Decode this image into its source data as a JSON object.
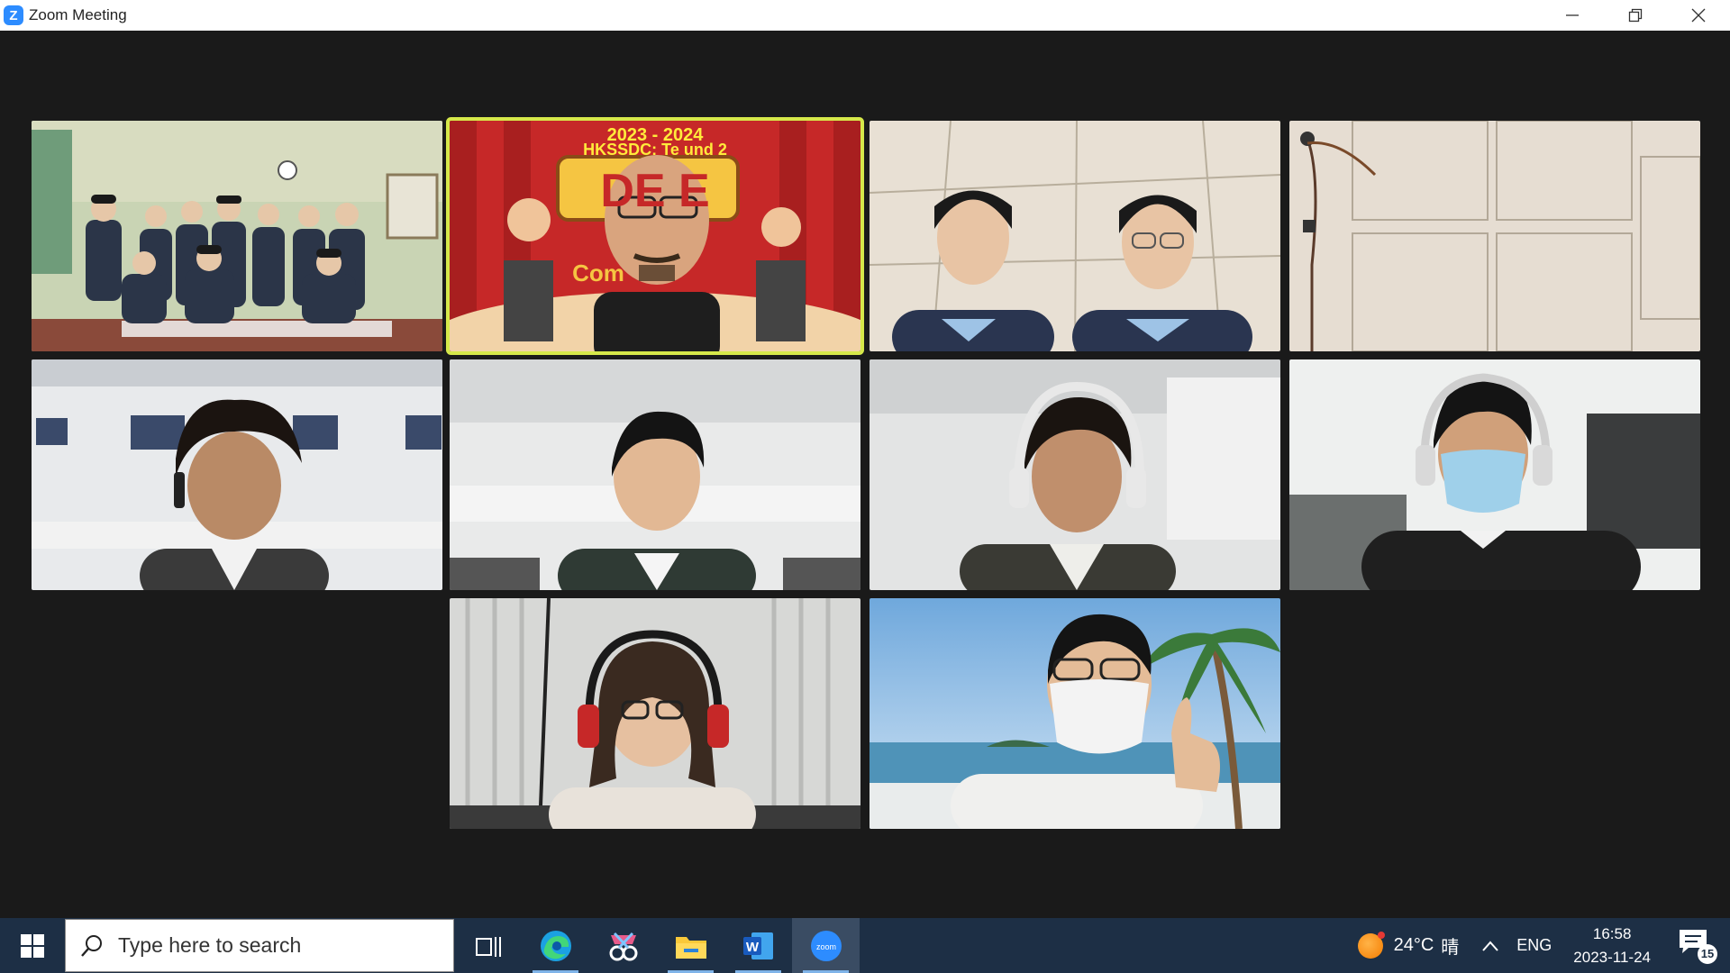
{
  "window": {
    "title": "Zoom Meeting",
    "logo_glyph": "Z",
    "controls": [
      "minimize-icon",
      "restore-icon",
      "close-icon"
    ]
  },
  "meeting": {
    "tiles": [
      {
        "id": "group-students",
        "active": false
      },
      {
        "id": "presenter",
        "active": true,
        "banner_year": "2023 - 2024",
        "banner_title": "HKSSDC: Te          und 2",
        "banner_big": "DE      E",
        "banner_sub": "Com"
      },
      {
        "id": "two-students",
        "active": false
      },
      {
        "id": "empty-room",
        "active": false
      },
      {
        "id": "student-curly",
        "active": false
      },
      {
        "id": "student-plain",
        "active": false
      },
      {
        "id": "student-headset",
        "active": false
      },
      {
        "id": "student-mask",
        "active": false
      },
      {
        "id": "student-glasses-headphones",
        "active": false
      },
      {
        "id": "student-beach",
        "active": false
      }
    ]
  },
  "taskbar": {
    "search_placeholder": "Type here to search",
    "apps": [
      "task-view-icon",
      "edge-icon",
      "snip-icon",
      "file-explorer-icon",
      "word-icon",
      "zoom-icon"
    ],
    "zoom_label": "zoom",
    "word_label": "W",
    "weather": {
      "temp": "24°C",
      "condition": "晴"
    },
    "language": "ENG",
    "time": "16:58",
    "date": "2023-11-24",
    "notifications": "15"
  },
  "colors": {
    "active_border": "#d6e84a",
    "taskbar": "#1d2f45",
    "zoom_blue": "#2d8cff"
  }
}
